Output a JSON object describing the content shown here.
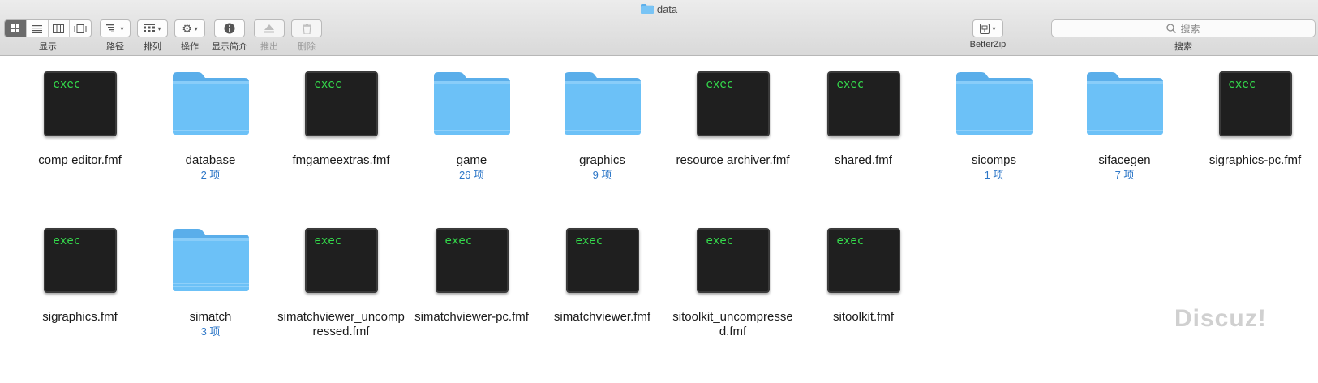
{
  "window": {
    "title": "data"
  },
  "toolbar": {
    "view": {
      "label": "显示"
    },
    "path": {
      "label": "路径"
    },
    "arrange": {
      "label": "排列"
    },
    "action": {
      "label": "操作"
    },
    "info": {
      "label": "显示简介"
    },
    "eject": {
      "label": "推出"
    },
    "delete": {
      "label": "删除"
    },
    "betterzip": {
      "label": "BetterZip"
    },
    "search": {
      "placeholder": "搜索",
      "label": "搜索"
    }
  },
  "files": [
    {
      "name": "comp editor.fmf",
      "type": "exec",
      "icon_text": "exec"
    },
    {
      "name": "database",
      "type": "folder",
      "count": "2 项"
    },
    {
      "name": "fmgameextras.fmf",
      "type": "exec",
      "icon_text": "exec"
    },
    {
      "name": "game",
      "type": "folder",
      "count": "26 项"
    },
    {
      "name": "graphics",
      "type": "folder",
      "count": "9 项"
    },
    {
      "name": "resource archiver.fmf",
      "type": "exec",
      "icon_text": "exec"
    },
    {
      "name": "shared.fmf",
      "type": "exec",
      "icon_text": "exec"
    },
    {
      "name": "sicomps",
      "type": "folder",
      "count": "1 项"
    },
    {
      "name": "sifacegen",
      "type": "folder",
      "count": "7 项"
    },
    {
      "name": "sigraphics-pc.fmf",
      "type": "exec",
      "icon_text": "exec"
    },
    {
      "name": "sigraphics.fmf",
      "type": "exec",
      "icon_text": "exec"
    },
    {
      "name": "simatch",
      "type": "folder",
      "count": "3 项"
    },
    {
      "name": "simatchviewer_uncompressed.fmf",
      "type": "exec",
      "icon_text": "exec"
    },
    {
      "name": "simatchviewer-pc.fmf",
      "type": "exec",
      "icon_text": "exec"
    },
    {
      "name": "simatchviewer.fmf",
      "type": "exec",
      "icon_text": "exec"
    },
    {
      "name": "sitoolkit_uncompressed.fmf",
      "type": "exec",
      "icon_text": "exec"
    },
    {
      "name": "sitoolkit.fmf",
      "type": "exec",
      "icon_text": "exec"
    }
  ],
  "watermark": {
    "text": "Discuz!"
  },
  "colors": {
    "folder": "#6cc1f7",
    "exec_text": "#34d94b",
    "count": "#2c76c7"
  }
}
